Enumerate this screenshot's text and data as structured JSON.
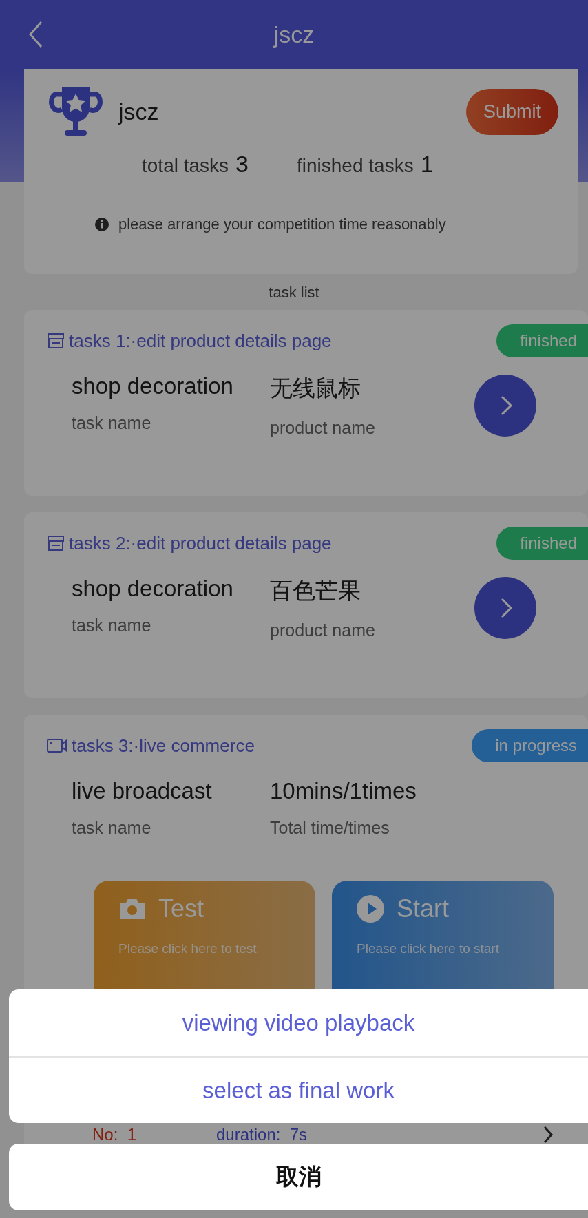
{
  "header": {
    "title": "jscz"
  },
  "summary": {
    "title": "jscz",
    "submit": "Submit",
    "total_label": "total tasks",
    "total": "3",
    "finished_label": "finished tasks",
    "finished": "1",
    "notice": "please arrange your competition time reasonably"
  },
  "section_title": "task list",
  "tasks": [
    {
      "kind": "shop",
      "title": "tasks 1:·edit product details page",
      "status": "finished",
      "color": "#1e7b4b",
      "fields": [
        {
          "value": "shop decoration",
          "label": "task name"
        },
        {
          "value": "无线鼠标",
          "label": "product name"
        }
      ]
    },
    {
      "kind": "shop",
      "title": "tasks 2:·edit product details page",
      "status": "finished",
      "color": "#1e7b4b",
      "fields": [
        {
          "value": "shop decoration",
          "label": "task name"
        },
        {
          "value": "百色芒果",
          "label": "product name"
        }
      ]
    },
    {
      "kind": "live",
      "title": "tasks 3:·live commerce",
      "status": "in progress",
      "color": "#246096",
      "fields": [
        {
          "value": "live broadcast",
          "label": "task name"
        },
        {
          "value": "10mins/1times",
          "label": "Total time/times"
        }
      ],
      "actions": [
        {
          "kind": "test",
          "title": "Test",
          "hint": "Please click here to test"
        },
        {
          "kind": "start",
          "title": "Start",
          "hint": "Please click here to start"
        }
      ],
      "record": {
        "no_label": "No:",
        "no": "1",
        "duration_label": "duration:",
        "duration": "7s"
      }
    }
  ],
  "sheet": {
    "options": [
      "viewing video playback",
      "select as final work"
    ],
    "cancel": "取消"
  }
}
